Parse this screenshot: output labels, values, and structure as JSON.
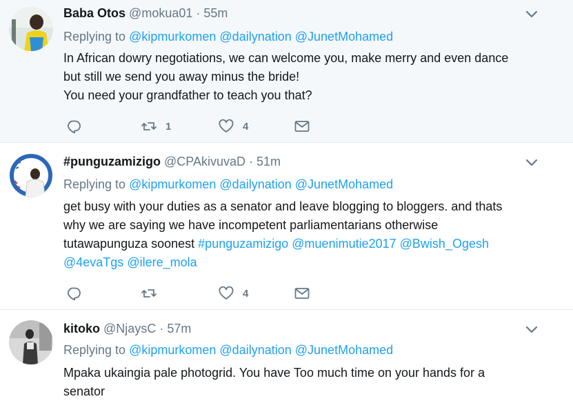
{
  "tweets": [
    {
      "name": "Baba Otos",
      "handle": "@mokua01",
      "separator": "·",
      "time": "55m",
      "replying_label": "Replying to",
      "mentions": [
        "@kipmurkomen",
        "@dailynation",
        "@JunetMohamed"
      ],
      "body_lines": [
        "In African dowry negotiations, we can welcome you, make merry and even dance",
        "but still we send you away minus the bride!",
        "You need your grandfather to teach you that?"
      ],
      "retweets": "1",
      "likes": "4"
    },
    {
      "name": "#punguzamizigo",
      "handle": "@CPAkivuvaD",
      "separator": "·",
      "time": "51m",
      "replying_label": "Replying to",
      "mentions": [
        "@kipmurkomen",
        "@dailynation",
        "@JunetMohamed"
      ],
      "body_line1": "get busy with your duties as a senator and leave blogging to bloggers. and thats",
      "body_line2": "why we are saying we have incompetent parliamentarians otherwise",
      "body_line3_text": "tutawapunguza soonest",
      "body_line3_links": [
        "#punguzamizigo",
        "@muenimutie2017",
        "@Bwish_Ogesh"
      ],
      "body_line4_links": [
        "@4evaTgs",
        "@ilere_mola"
      ],
      "retweets": "",
      "likes": "4"
    },
    {
      "name": "kitoko",
      "handle": "@NjaysC",
      "separator": "·",
      "time": "57m",
      "replying_label": "Replying to",
      "mentions": [
        "@kipmurkomen",
        "@dailynation",
        "@JunetMohamed"
      ],
      "body_lines": [
        "Mpaka ukaingia pale photogrid. You have Too much time on your  hands for a",
        "senator"
      ]
    }
  ],
  "colors": {
    "link": "#1da1f2",
    "muted": "#657786",
    "text": "#14171a",
    "highlight_bg": "#f5f8fa",
    "border": "#e6ecf0"
  },
  "icons": [
    "reply-icon",
    "retweet-icon",
    "like-icon",
    "message-icon",
    "chevron-down-icon"
  ]
}
